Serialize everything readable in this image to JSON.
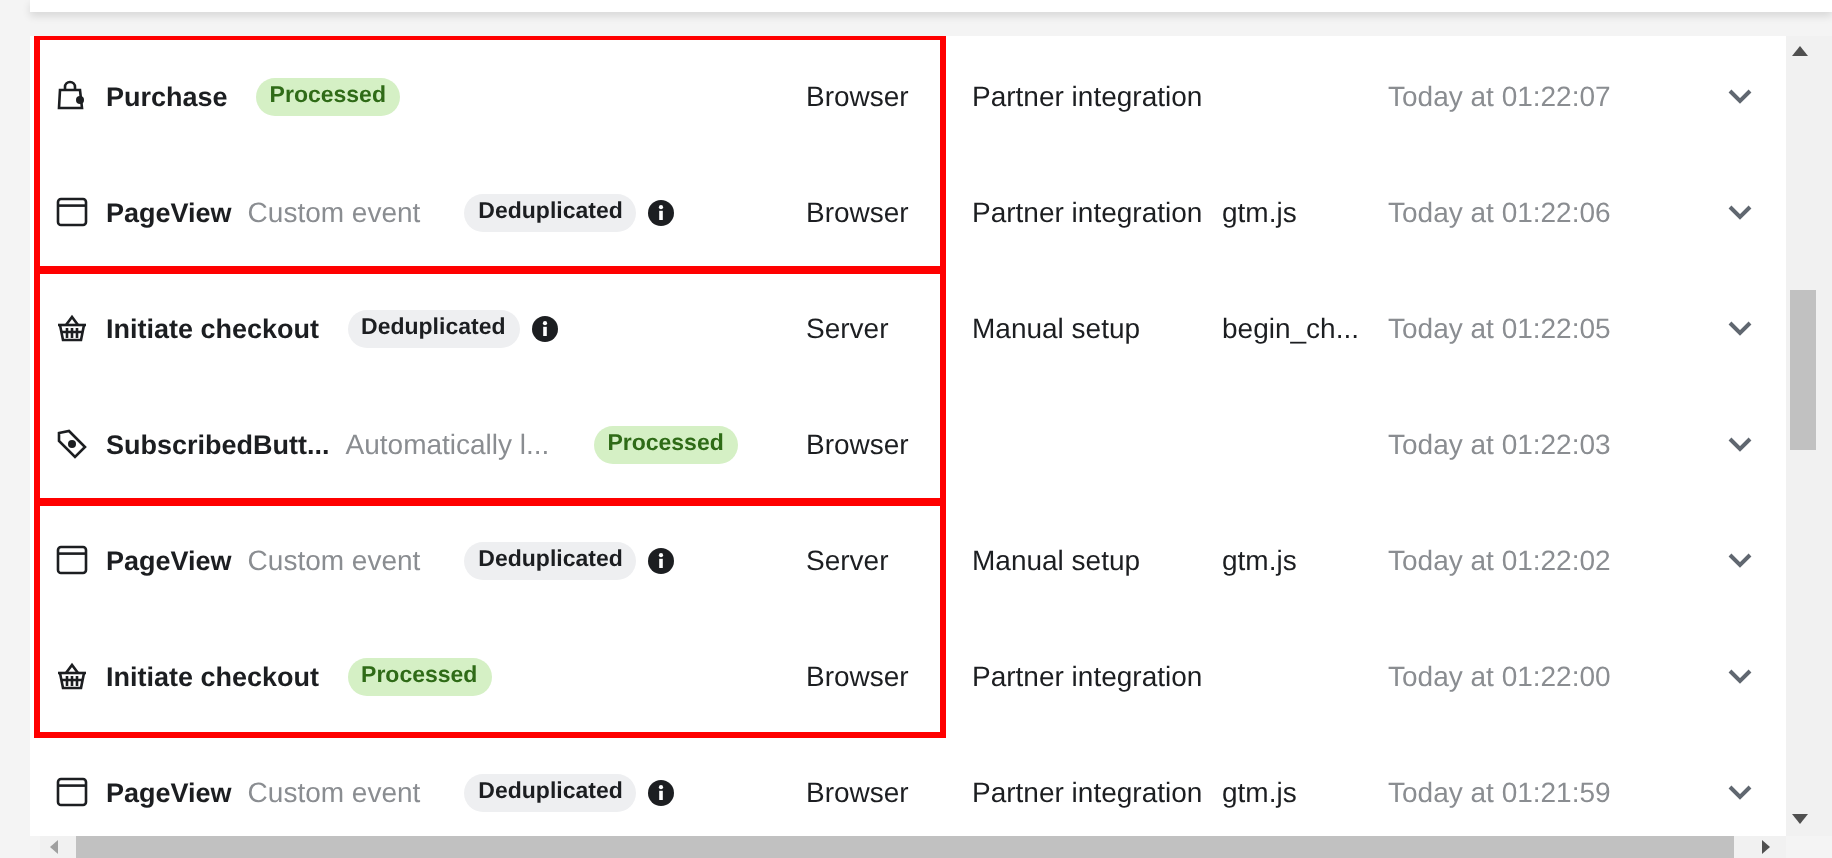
{
  "groups": [
    {
      "highlighted": true,
      "rows": [
        {
          "kind": "bag",
          "name": "Purchase",
          "badge": {
            "text": "Processed",
            "kind": "processed"
          },
          "info": false,
          "source": "Browser",
          "integration": "Partner integration",
          "time": "Today at 01:22:07"
        },
        {
          "kind": "window",
          "name": "PageView",
          "subtitle": "Custom event",
          "badge": {
            "text": "Deduplicated",
            "kind": "deduplicated"
          },
          "info": true,
          "source": "Browser",
          "integration": "Partner integration",
          "parameter": "gtm.js",
          "time": "Today at 01:22:06"
        }
      ]
    },
    {
      "highlighted": true,
      "rows": [
        {
          "kind": "basket",
          "name": "Initiate checkout",
          "badge": {
            "text": "Deduplicated",
            "kind": "deduplicated"
          },
          "info": true,
          "source": "Server",
          "integration": "Manual setup",
          "parameter": "begin_ch...",
          "time": "Today at 01:22:05"
        },
        {
          "kind": "tag",
          "name": "SubscribedButt...",
          "subtitle": "Automatically l...",
          "badge": {
            "text": "Processed",
            "kind": "processed"
          },
          "info": false,
          "source": "Browser",
          "time": "Today at 01:22:03"
        }
      ]
    },
    {
      "highlighted": true,
      "rows": [
        {
          "kind": "window",
          "name": "PageView",
          "subtitle": "Custom event",
          "badge": {
            "text": "Deduplicated",
            "kind": "deduplicated"
          },
          "info": true,
          "source": "Server",
          "integration": "Manual setup",
          "parameter": "gtm.js",
          "time": "Today at 01:22:02"
        },
        {
          "kind": "basket",
          "name": "Initiate checkout",
          "badge": {
            "text": "Processed",
            "kind": "processed"
          },
          "info": false,
          "source": "Browser",
          "integration": "Partner integration",
          "time": "Today at 01:22:00"
        }
      ]
    },
    {
      "highlighted": false,
      "rows": [
        {
          "kind": "window",
          "name": "PageView",
          "subtitle": "Custom event",
          "badge": {
            "text": "Deduplicated",
            "kind": "deduplicated"
          },
          "info": true,
          "source": "Browser",
          "integration": "Partner integration",
          "parameter": "gtm.js",
          "time": "Today at 01:21:59"
        }
      ]
    }
  ]
}
